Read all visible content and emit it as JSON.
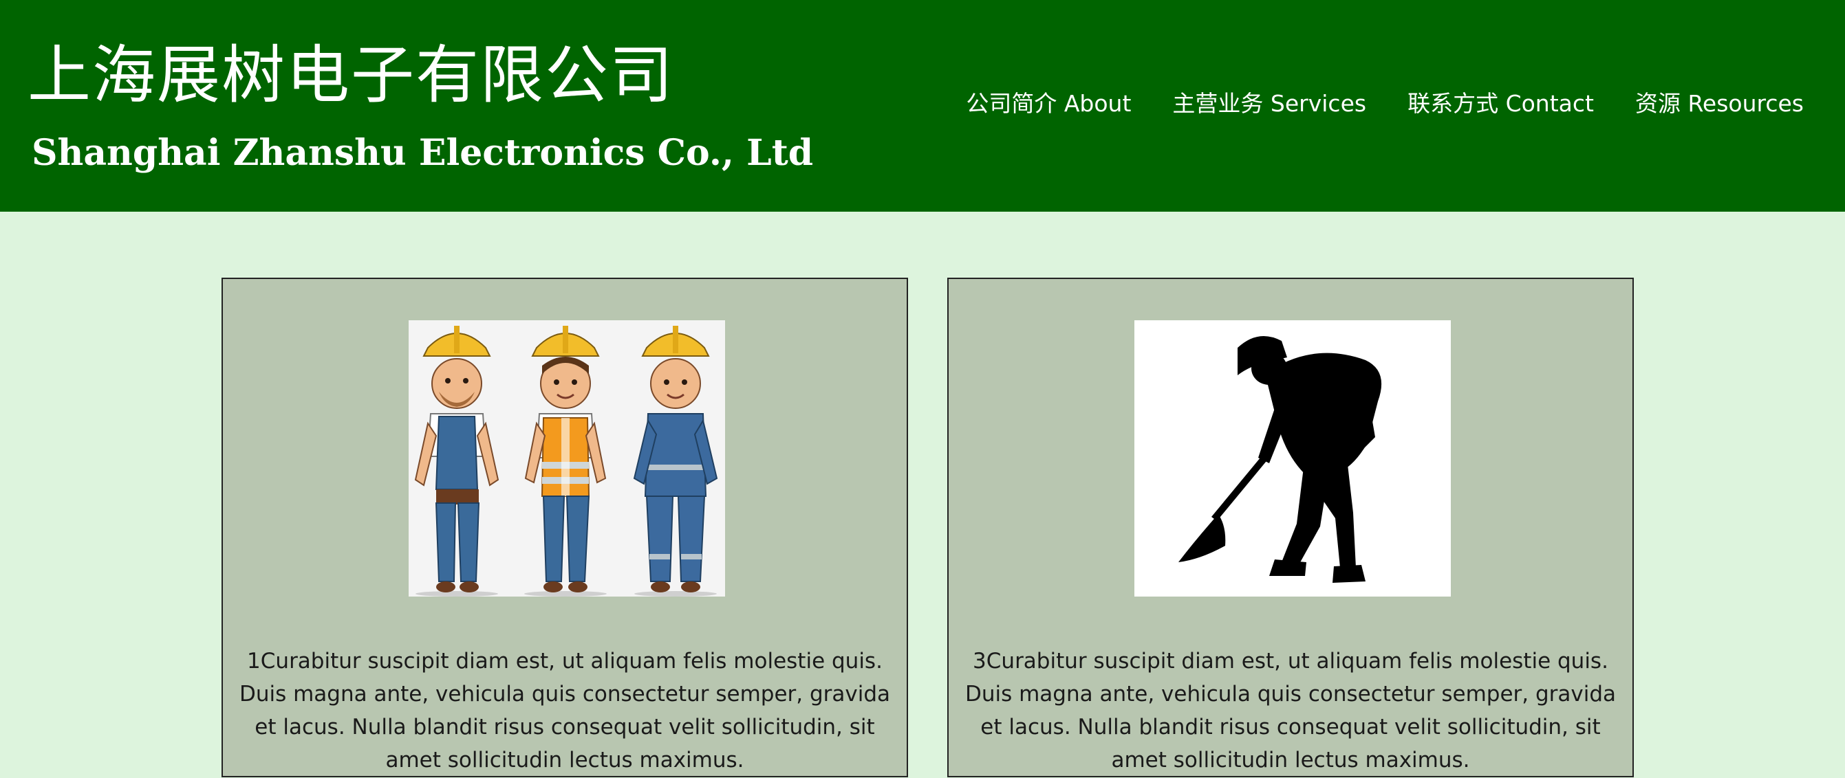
{
  "header": {
    "title_cn": "上海展树电子有限公司",
    "title_en": "Shanghai Zhanshu Electronics Co., Ltd",
    "background": "#006400"
  },
  "nav": {
    "items": [
      {
        "label": "公司简介 About"
      },
      {
        "label": "主营业务 Services"
      },
      {
        "label": "联系方式 Contact"
      },
      {
        "label": "资源 Resources"
      }
    ]
  },
  "cards": [
    {
      "image": "three-construction-workers-illustration",
      "text": "1Curabitur suscipit diam est, ut aliquam felis molestie quis. Duis magna ante, vehicula quis consectetur semper, gravida et lacus. Nulla blandit risus consequat velit sollicitudin, sit amet sollicitudin lectus maximus."
    },
    {
      "image": "worker-shoveling-silhouette",
      "text": "3Curabitur suscipit diam est, ut aliquam felis molestie quis. Duis magna ante, vehicula quis consectetur semper, gravida et lacus. Nulla blandit risus consequat velit sollicitudin, sit amet sollicitudin lectus maximus."
    }
  ],
  "colors": {
    "page_background": "#ddf4dd",
    "card_background": "#b8c6b0"
  }
}
